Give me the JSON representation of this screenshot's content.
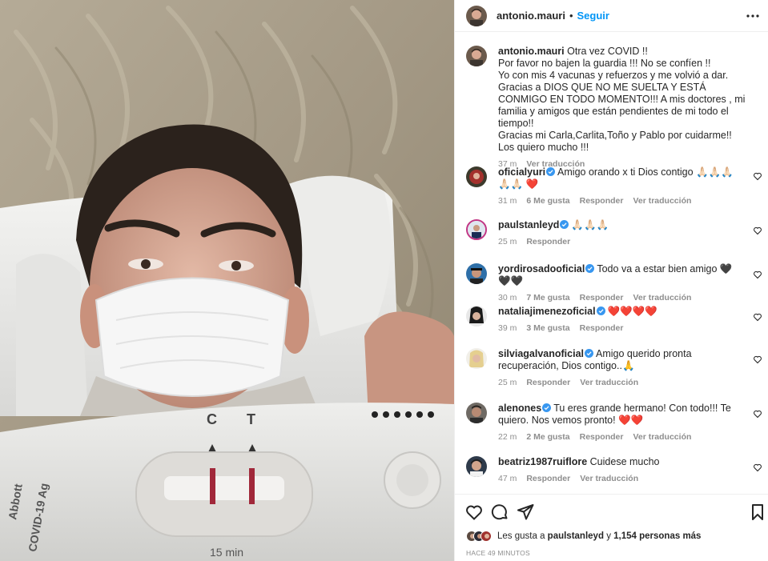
{
  "post": {
    "username": "antonio.mauri",
    "dot": "•",
    "follow_label": "Seguir"
  },
  "caption": {
    "username": "antonio.mauri",
    "text": "Otra vez COVID !!\nPor favor no bajen la guardia !!! No se confíen !!\nYo con mis 4 vacunas y refuerzos y me volvió a dar.\nGracias a DIOS QUE NO ME SUELTA Y ESTÁ CONMIGO EN TODO MOMENTO!!! A mis doctores , mi familia y amigos que están pendientes de mi todo el tiempo!!\nGracias mi Carla,Carlita,Toño y Pablo por cuidarme!!\nLos quiero mucho !!!",
    "time": "37 m",
    "translate": "Ver traducción"
  },
  "comments": [
    {
      "user": "oficialyuri",
      "verified": true,
      "text": "Amigo orando x ti Dios contigo 🙏🏻🙏🏻🙏🏻🙏🏻🙏🏻 ❤️",
      "time": "31 m",
      "likes": "6 Me gusta",
      "reply": "Responder",
      "translate": "Ver traducción"
    },
    {
      "user": "paulstanleyd",
      "verified": true,
      "text": "🙏🏻🙏🏻🙏🏻",
      "time": "25 m",
      "likes": "",
      "reply": "Responder",
      "translate": ""
    },
    {
      "user": "yordirosadooficial",
      "verified": true,
      "text": "Todo va a estar bien amigo 🖤🖤🖤",
      "time": "30 m",
      "likes": "7 Me gusta",
      "reply": "Responder",
      "translate": "Ver traducción"
    },
    {
      "user": "nataliajimenezoficial",
      "verified": true,
      "text": "❤️❤️❤️❤️",
      "time": "39 m",
      "likes": "3 Me gusta",
      "reply": "Responder",
      "translate": ""
    },
    {
      "user": "silviagalvanoficial",
      "verified": true,
      "text": "Amigo querido pronta recuperación, Dios contigo..🙏",
      "time": "25 m",
      "likes": "",
      "reply": "Responder",
      "translate": "Ver traducción"
    },
    {
      "user": "alenones",
      "verified": true,
      "text": "Tu eres grande hermano! Con todo!!! Te quiero. Nos vemos pronto! ❤️❤️",
      "time": "22 m",
      "likes": "2 Me gusta",
      "reply": "Responder",
      "translate": "Ver traducción"
    },
    {
      "user": "beatriz1987ruiflore",
      "verified": false,
      "text": "Cuidese mucho",
      "time": "47 m",
      "likes": "",
      "reply": "Responder",
      "translate": "Ver traducción"
    }
  ],
  "likes": {
    "prefix": "Les gusta a",
    "user": "paulstanleyd",
    "connector": "y",
    "count": "1,154 personas más"
  },
  "timeago": "HACE 49 MINUTOS",
  "icons": {
    "more": "more-icon",
    "heart": "heart-icon",
    "comment": "comment-icon",
    "share": "share-icon",
    "save": "bookmark-icon",
    "verified": "verified-badge-icon"
  },
  "colors": {
    "accent": "#0095f6",
    "verified": "#3897f0",
    "muted": "#8e8e8e",
    "text": "#262626"
  }
}
